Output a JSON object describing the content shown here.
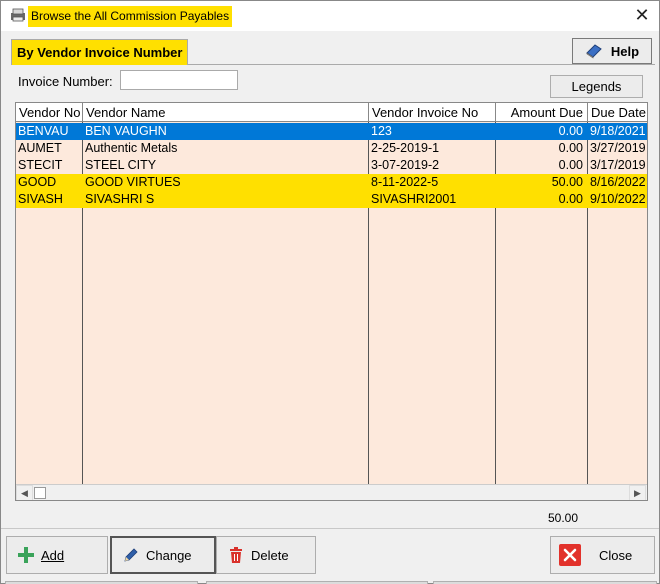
{
  "window": {
    "title": "Browse the All Commission Payables",
    "close_glyph": "✕"
  },
  "tab": {
    "label": "By Vendor Invoice Number"
  },
  "help_button": {
    "label": "Help",
    "icon": "help-book-icon"
  },
  "legends_button": {
    "label": "Legends"
  },
  "search": {
    "label": "Invoice Number:",
    "value": "",
    "placeholder": ""
  },
  "grid": {
    "columns": [
      "Vendor No",
      "Vendor Name",
      "Vendor Invoice No",
      "Amount Due",
      "Due Date"
    ],
    "rows": [
      {
        "vendor_no": "BENVAU",
        "vendor_name": "BEN VAUGHN",
        "invoice_no": "123",
        "amount_due": "0.00",
        "due_date": "9/18/2021",
        "state": "selected"
      },
      {
        "vendor_no": "AUMET",
        "vendor_name": "Authentic Metals",
        "invoice_no": "2-25-2019-1",
        "amount_due": "0.00",
        "due_date": "3/27/2019",
        "state": "normal"
      },
      {
        "vendor_no": "STECIT",
        "vendor_name": "STEEL CITY",
        "invoice_no": "3-07-2019-2",
        "amount_due": "0.00",
        "due_date": "3/17/2019",
        "state": "normal"
      },
      {
        "vendor_no": "GOOD",
        "vendor_name": "GOOD VIRTUES",
        "invoice_no": "8-11-2022-5",
        "amount_due": "50.00",
        "due_date": "8/16/2022",
        "state": "highlight"
      },
      {
        "vendor_no": "SIVASH",
        "vendor_name": "SIVASHRI S",
        "invoice_no": "SIVASHRI2001",
        "amount_due": "0.00",
        "due_date": "9/10/2022",
        "state": "highlight"
      }
    ]
  },
  "total_amount_due": "50.00",
  "buttons": {
    "add": "Add",
    "change": "Change",
    "delete": "Delete",
    "close": "Close"
  },
  "colors": {
    "highlight": "#ffe000",
    "selected": "#0078d7",
    "grid_background": "#fde9dc",
    "add_icon": "#3aa35a",
    "delete_icon": "#d9312b",
    "close_icon": "#e2322b"
  }
}
